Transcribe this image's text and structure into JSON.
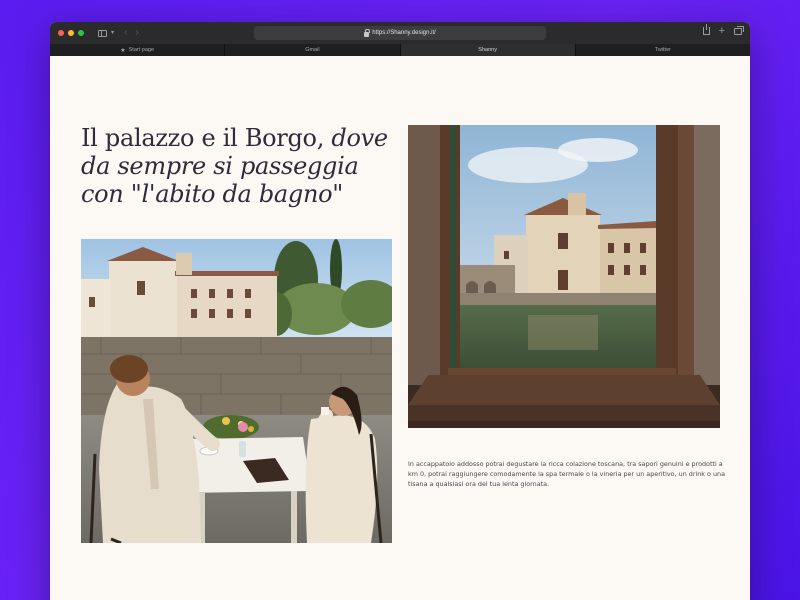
{
  "browser": {
    "url": "https://Shanny.design.it/",
    "tabs": [
      {
        "label": "Start page",
        "active": false
      },
      {
        "label": "Gmail",
        "active": false
      },
      {
        "label": "Shanny",
        "active": true
      },
      {
        "label": "Twitter",
        "active": false
      }
    ]
  },
  "page": {
    "headline_plain": "Il palazzo e il Borgo,",
    "headline_italic": "dove da sempre si passeggia con \"l'abito da bagno\"",
    "caption": "In accappatoio addosso potrai degustare la ricca colazione toscana, tra sapori genuini e prodotti a km 0, potrai raggiungere comodamente la spa termale o la vineria per un aperitivo, un drink o una tisana a qualsiasi ora del tua lenta giornata."
  },
  "colors": {
    "background": "#6a22f5",
    "page_bg": "#fcf8f3",
    "text": "#2f2b3a"
  }
}
